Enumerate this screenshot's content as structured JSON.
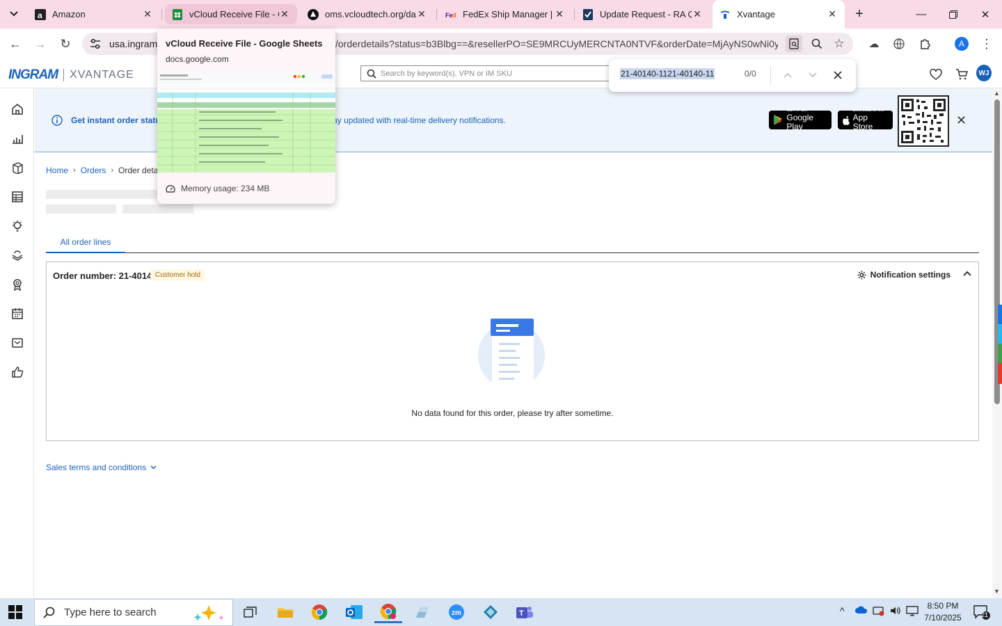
{
  "browser": {
    "tabs": [
      {
        "title": "Amazon",
        "favicon": "amazon-icon"
      },
      {
        "title": "vCloud Receive File - Gc",
        "favicon": "sheets-icon"
      },
      {
        "title": "oms.vcloudtech.org/da",
        "favicon": "vcloud-icon"
      },
      {
        "title": "FedEx Ship Manager | C",
        "favicon": "fedex-icon"
      },
      {
        "title": "Update Request - RA Q",
        "favicon": "checkmark-icon"
      },
      {
        "title": "Xvantage",
        "favicon": "xvantage-icon"
      }
    ],
    "address": {
      "host": "usa.ingram",
      "path": "/orderdetails?status=b3Blbg==&resellerPO=SE9MRCUyMERCNTA0NTVF&orderDate=MjAyNS0wNi0y..."
    },
    "profile_initial": "A"
  },
  "tab_preview": {
    "title": "vCloud Receive File - Google Sheets",
    "url": "docs.google.com",
    "memory": "Memory usage: 234 MB"
  },
  "find_bar": {
    "query": "21-40140-1121-40140-11",
    "count": "0/0"
  },
  "header": {
    "logo_left": "INGRAM",
    "logo_right": "XVANTAGE",
    "search_placeholder": "Search by keyword(s), VPN or IM SKU",
    "user_initials": "WJ"
  },
  "banner": {
    "text_bold": "Get instant order status",
    "text_rest": "app and stay updated with real-time delivery notifications.",
    "google_play_small": "GET IT ON",
    "google_play": "Google Play",
    "app_store_small": "Download on the",
    "app_store": "App Store"
  },
  "breadcrumb": [
    "Home",
    "Orders",
    "Order details"
  ],
  "tabs": {
    "all_order_lines": "All order lines"
  },
  "order": {
    "number_label": "Order number: 21-40140",
    "status": "Customer hold",
    "notification_settings": "Notification settings",
    "empty_message": "No data found for this order, please try after sometime."
  },
  "sales_terms": "Sales terms and conditions",
  "taskbar": {
    "search_placeholder": "Type here to search",
    "time": "8:50 PM",
    "date": "7/10/2025",
    "notifications": "21"
  },
  "colors": {
    "brand_blue": "#1a62b8",
    "tabstrip": "#f8dbe7",
    "badge_bg": "#fff8e6"
  }
}
